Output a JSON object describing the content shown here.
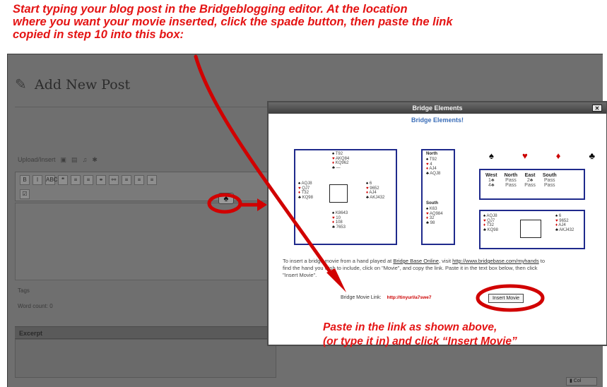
{
  "instruction_top": "Start typing your blog post in the Bridgeblogging editor.  At the location\nwhere you want your movie inserted, click the spade button, then paste the link\ncopied in step 10 into this box:",
  "instruction_bottom": "Paste in the link as shown above,\n(or type it in) and click “Insert Movie”",
  "wp": {
    "page_title": "Add New Post",
    "upload_label": "Upload/Insert",
    "toolbar_buttons": [
      "B",
      "I",
      "ABC",
      "❝",
      "≡",
      "≡",
      "⚭",
      "⚯",
      "≡",
      "≡",
      "≡"
    ],
    "tags_label": "Tags",
    "word_count": "Word count: 0",
    "excerpt_label": "Excerpt"
  },
  "modal": {
    "title": "Bridge Elements",
    "close_label": "✕",
    "heading": "Bridge Elements!",
    "description_prefix": "To insert a bridge movie from a hand played at ",
    "description_link1": "Bridge Base Online",
    "description_mid": ", visit ",
    "description_link2": "http://www.bridgebase.com/myhands",
    "description_suffix": " to find the hand you wish to include, click on \"Movie\", and copy the link. Paste it in the text box below, then click \"Insert Movie\".",
    "link_label": "Bridge Movie Link:",
    "link_value": "http://tinyurl/a7swe7",
    "insert_button": "Insert Movie",
    "suits": [
      "♠",
      "♥",
      "♦",
      "♣"
    ],
    "auction": {
      "headers": [
        "West",
        "North",
        "East",
        "South"
      ],
      "rows": [
        [
          "1♣",
          "Pass",
          "2♣",
          "Pass"
        ],
        [
          "4♣",
          "Pass",
          "Pass",
          "Pass"
        ]
      ]
    },
    "diagram1": {
      "north": [
        "♠ T92",
        "♥ AKQ84",
        "♦ KQ962",
        "♣ —"
      ],
      "west": [
        "♠ AQJ8",
        "♥ QJ7",
        "♦ T32",
        "♣ KQ98"
      ],
      "east": [
        "♠ 6",
        "♥ 9652",
        "♦ AJ4",
        "♣ AKJ432"
      ],
      "south": [
        "♠ K8643",
        "♥ 10",
        "♦ 108",
        "♣ 7653"
      ]
    },
    "diagram2": {
      "north_label": "North",
      "south_label": "South",
      "north": [
        "♠ T92",
        "♥ 4",
        "♦ AJ4",
        "♣ AQJ8"
      ],
      "south": [
        "♠ K63",
        "♥ AQ984",
        "♦ 32",
        "♣ 98"
      ]
    },
    "diagram3": {
      "west": [
        "♠ AQJ8",
        "♥ QJ7",
        "♦ T32",
        "♣ KQ98"
      ],
      "east": [
        "♠ 6",
        "♥ 9652",
        "♦ AJ4",
        "♣ AKJ432"
      ]
    }
  }
}
